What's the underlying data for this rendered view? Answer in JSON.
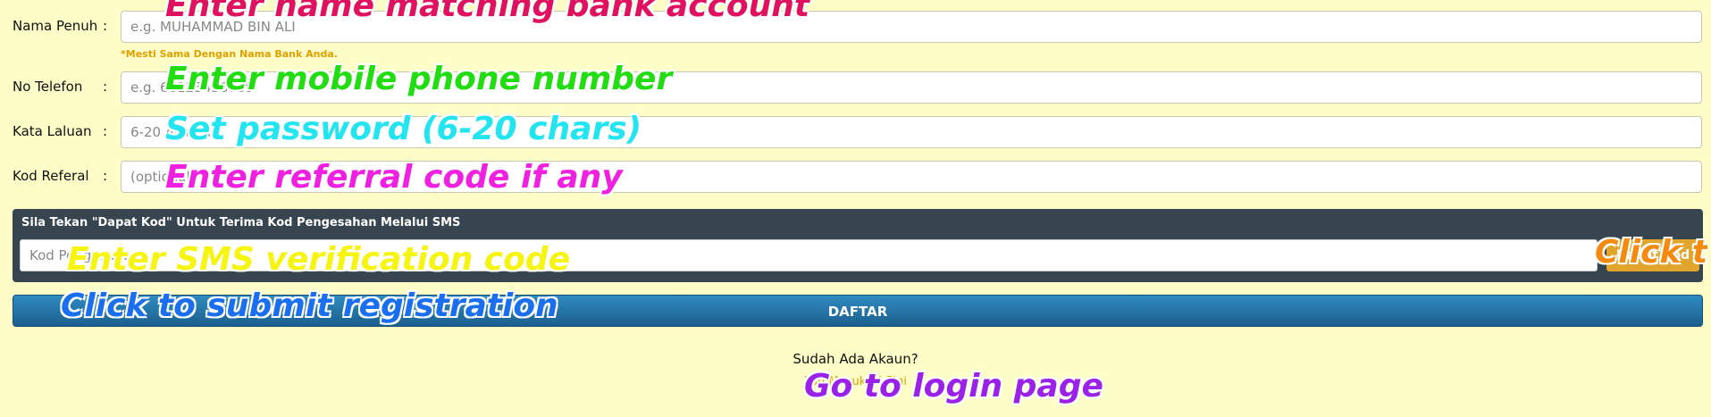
{
  "form": {
    "fullname": {
      "label": "Nama Penuh",
      "colon": ":",
      "placeholder": "e.g. MUHAMMAD BIN ALI",
      "note": "*Mesti Sama Dengan Nama Bank Anda."
    },
    "phone": {
      "label": "No Telefon",
      "colon": ":",
      "placeholder": "e.g. 60123456789"
    },
    "password": {
      "label": "Kata Laluan",
      "colon": ":",
      "placeholder": "6-20 Aksara"
    },
    "referral": {
      "label": "Kod Referal",
      "colon": ":",
      "placeholder": "(optional)"
    }
  },
  "sms": {
    "title": "Sila Tekan \"Dapat Kod\" Untuk Terima Kod Pengesahan Melalui SMS",
    "placeholder": "Kod Pengesahan",
    "button": "Dapat Kod"
  },
  "submit_label": "DAFTAR",
  "login": {
    "question": "Sudah Ada Akaun?",
    "link": "Log Masuk Di Sini"
  },
  "annotations": {
    "name": "Enter name matching bank account",
    "phone": "Enter mobile phone number",
    "password": "Set password (6-20 chars)",
    "referral": "Enter referral code if any",
    "sms": "Enter SMS verification code",
    "get_code": "Click to",
    "submit": "Click to submit registration",
    "login": "Go to login page"
  },
  "colors": {
    "background": "#fdfdc8",
    "sms_panel": "#36454f",
    "get_code_button": "#e0a52a",
    "submit_button": "#1f6fa5",
    "annotation_name": "#e0115f",
    "annotation_phone": "#22dd11",
    "annotation_password": "#22e5f0",
    "annotation_referral": "#f020e0",
    "annotation_sms": "#f5f511",
    "annotation_get_code": "#f58a11",
    "annotation_submit": "#1a6ff0",
    "annotation_login": "#9a22e8"
  }
}
